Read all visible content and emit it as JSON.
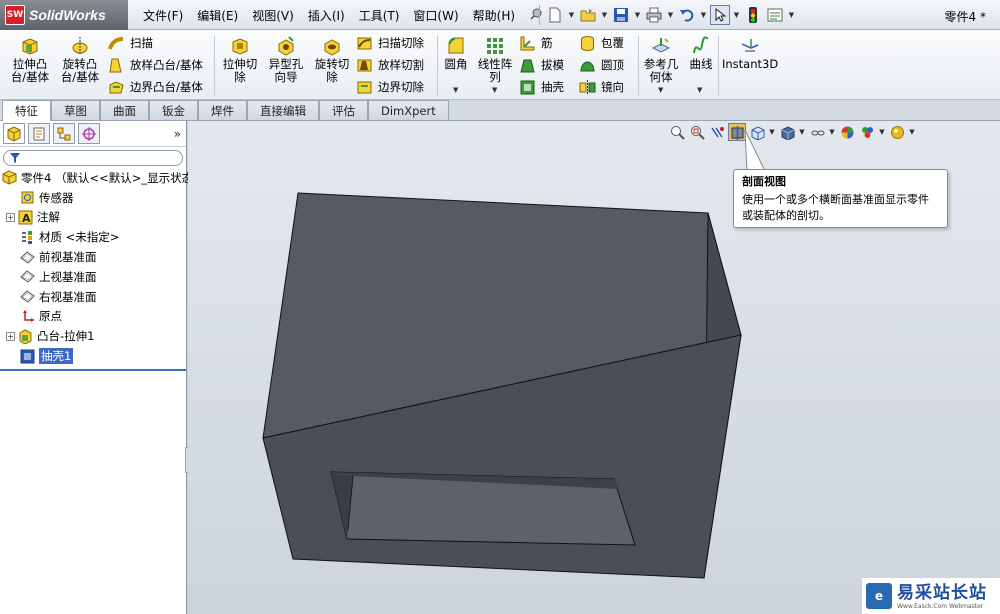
{
  "app": {
    "name": "SolidWorks",
    "logo_mark": "SW",
    "document_title": "零件4 *"
  },
  "menu": [
    "文件(F)",
    "编辑(E)",
    "视图(V)",
    "插入(I)",
    "工具(T)",
    "窗口(W)",
    "帮助(H)"
  ],
  "ribbon": {
    "extrude_boss": "拉伸凸\n台/基体",
    "revolve_boss": "旋转凸\n台/基体",
    "sweep": "扫描",
    "loft_boss": "放样凸台/基体",
    "boundary_boss": "边界凸台/基体",
    "extrude_cut": "拉伸切\n除",
    "hole_wizard": "异型孔\n向导",
    "revolve_cut": "旋转切\n除",
    "swept_cut": "扫描切除",
    "lofted_cut": "放样切割",
    "boundary_cut": "边界切除",
    "fillet": "圆角",
    "linear_pattern": "线性阵\n列",
    "rib": "筋",
    "draft": "拔模",
    "shell": "抽壳",
    "wrap": "包覆",
    "dome": "圆顶",
    "mirror": "镜向",
    "ref_geometry": "参考几\n何体",
    "curves": "曲线",
    "instant3d": "Instant3D"
  },
  "tabs": [
    "特征",
    "草图",
    "曲面",
    "钣金",
    "焊件",
    "直接编辑",
    "评估",
    "DimXpert"
  ],
  "active_tab": 0,
  "tree": {
    "root": "零件4 （默认<<默认>_显示状态",
    "items": [
      {
        "label": "传感器",
        "icon": "sensor-icon",
        "expander": ""
      },
      {
        "label": "注解",
        "icon": "annotation-icon",
        "expander": "+"
      },
      {
        "label": "材质 <未指定>",
        "icon": "material-icon",
        "expander": ""
      },
      {
        "label": "前视基准面",
        "icon": "plane-icon",
        "expander": ""
      },
      {
        "label": "上视基准面",
        "icon": "plane-icon",
        "expander": ""
      },
      {
        "label": "右视基准面",
        "icon": "plane-icon",
        "expander": ""
      },
      {
        "label": "原点",
        "icon": "origin-icon",
        "expander": ""
      },
      {
        "label": "凸台-拉伸1",
        "icon": "boss-extrude-icon",
        "expander": "+"
      },
      {
        "label": "抽壳1",
        "icon": "shell-icon",
        "expander": "",
        "selected": true
      }
    ]
  },
  "tooltip": {
    "title": "剖面视图",
    "body": "使用一个或多个横断面基准面显示零件或装配体的剖切。"
  },
  "watermark": {
    "text": "易采站长站",
    "sub": "Www.Easck.Com  Webmaster"
  },
  "colors": {
    "model_face_front": "#4a4c56",
    "model_face_top": "#585a66",
    "model_face_side": "#44464f",
    "selection": "#3b6bc6"
  }
}
